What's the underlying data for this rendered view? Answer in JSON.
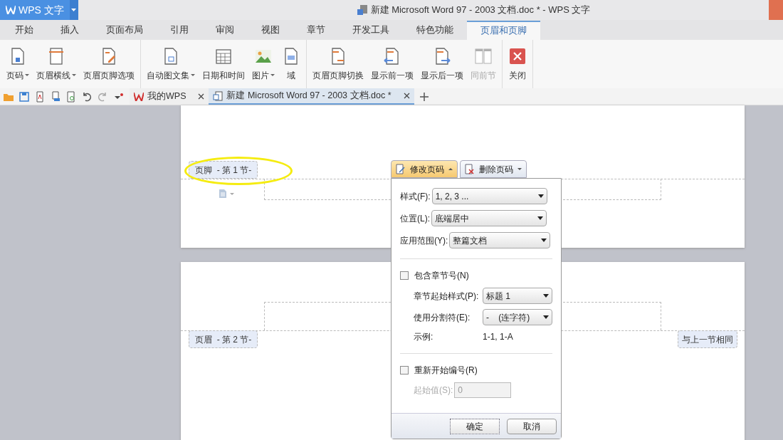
{
  "app_button": {
    "label": "WPS 文字"
  },
  "window": {
    "title": "新建 Microsoft Word 97 - 2003 文档.doc * - WPS 文字"
  },
  "menu_tabs": [
    {
      "label": "开始",
      "selected": false
    },
    {
      "label": "插入",
      "selected": false
    },
    {
      "label": "页面布局",
      "selected": false
    },
    {
      "label": "引用",
      "selected": false
    },
    {
      "label": "审阅",
      "selected": false
    },
    {
      "label": "视图",
      "selected": false
    },
    {
      "label": "章节",
      "selected": false
    },
    {
      "label": "开发工具",
      "selected": false
    },
    {
      "label": "特色功能",
      "selected": false
    },
    {
      "label": "页眉和页脚",
      "selected": true
    }
  ],
  "ribbon_groups": [
    [
      {
        "kind": "page-number",
        "label": "页码",
        "has_menu": true,
        "disabled": false
      },
      {
        "kind": "header-line",
        "label": "页眉横线",
        "has_menu": true,
        "disabled": false
      },
      {
        "kind": "options",
        "label": "页眉页脚选项",
        "has_menu": false,
        "disabled": false
      }
    ],
    [
      {
        "kind": "autotext",
        "label": "自动图文集",
        "has_menu": true,
        "disabled": false
      },
      {
        "kind": "datetime",
        "label": "日期和时间",
        "has_menu": false,
        "disabled": false
      },
      {
        "kind": "picture",
        "label": "图片",
        "has_menu": true,
        "disabled": false
      },
      {
        "kind": "field",
        "label": "域",
        "has_menu": false,
        "disabled": false
      }
    ],
    [
      {
        "kind": "switch",
        "label": "页眉页脚切换",
        "has_menu": false,
        "disabled": false
      },
      {
        "kind": "prev",
        "label": "显示前一项",
        "has_menu": false,
        "disabled": false
      },
      {
        "kind": "next",
        "label": "显示后一项",
        "has_menu": false,
        "disabled": false
      },
      {
        "kind": "same",
        "label": "同前节",
        "has_menu": false,
        "disabled": true
      }
    ],
    [
      {
        "kind": "close",
        "label": "关闭",
        "has_menu": false,
        "disabled": false
      }
    ]
  ],
  "doc_tabs": [
    {
      "kind": "wps",
      "label": "我的WPS",
      "selected": false
    },
    {
      "kind": "doc",
      "label": "新建 Microsoft Word 97 - 2003 文档.doc *",
      "selected": true
    }
  ],
  "page1": {
    "footer_label": "页脚  - 第 1 节-"
  },
  "page2": {
    "header_label": "页眉  - 第 2 节-",
    "link_label": "与上一节相同"
  },
  "popup": {
    "tabs": [
      {
        "label": "修改页码",
        "selected": true
      },
      {
        "label": "删除页码",
        "selected": false
      }
    ],
    "style": {
      "label": "样式(F):",
      "value": "1, 2, 3 ..."
    },
    "position": {
      "label": "位置(L):",
      "value": "底端居中"
    },
    "scope": {
      "label": "应用范围(Y):",
      "value": "整篇文档"
    },
    "include_chapter": {
      "label": "包含章节号(N)",
      "checked": false
    },
    "chapter_style": {
      "label": "章节起始样式(P):",
      "value": "标题 1"
    },
    "separator": {
      "label": "使用分割符(E):",
      "value": "-    (连字符)"
    },
    "example": {
      "label": "示例:",
      "value": "1-1, 1-A"
    },
    "restart": {
      "label": "重新开始编号(R)",
      "checked": false
    },
    "start_value": {
      "label": "起始值(S):",
      "value": "0",
      "disabled": true
    },
    "ok": "确定",
    "cancel": "取消"
  }
}
